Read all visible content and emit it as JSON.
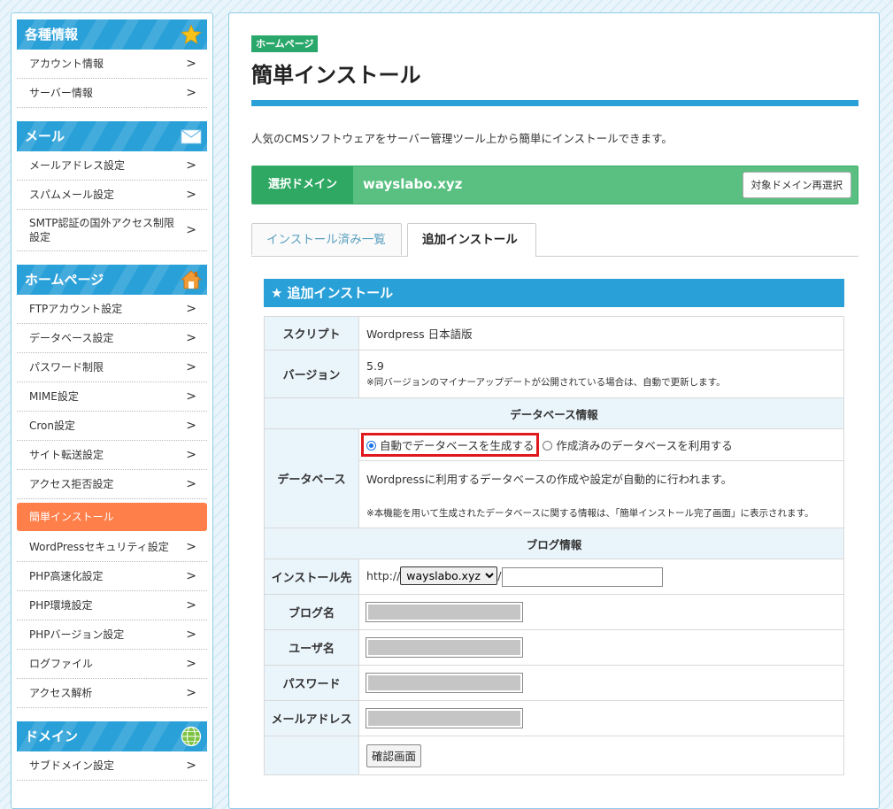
{
  "sidebar": {
    "sections": [
      {
        "title": "各種情報",
        "icon": "star-icon",
        "items": [
          "アカウント情報",
          "サーバー情報"
        ]
      },
      {
        "title": "メール",
        "icon": "envelope-icon",
        "items": [
          "メールアドレス設定",
          "スパムメール設定",
          "SMTP認証の国外アクセス制限設定"
        ]
      },
      {
        "title": "ホームページ",
        "icon": "house-icon",
        "items": [
          "FTPアカウント設定",
          "データベース設定",
          "パスワード制限",
          "MIME設定",
          "Cron設定",
          "サイト転送設定",
          "アクセス拒否設定",
          "簡単インストール",
          "WordPressセキュリティ設定",
          "PHP高速化設定",
          "PHP環境設定",
          "PHPバージョン設定",
          "ログファイル",
          "アクセス解析"
        ],
        "active": "簡単インストール"
      },
      {
        "title": "ドメイン",
        "icon": "globe-icon",
        "items": [
          "サブドメイン設定"
        ]
      }
    ],
    "chevron": ">"
  },
  "main": {
    "badge": "ホームページ",
    "title": "簡単インストール",
    "intro": "人気のCMSソフトウェアをサーバー管理ツール上から簡単にインストールできます。",
    "domain": {
      "label": "選択ドメイン",
      "value": "wayslabo.xyz",
      "reselect_button": "対象ドメイン再選択"
    },
    "tabs": [
      "インストール済み一覧",
      "追加インストール"
    ],
    "active_tab": "追加インストール",
    "panel_title": "追加インストール",
    "form": {
      "script_label": "スクリプト",
      "script_value": "Wordpress 日本語版",
      "version_label": "バージョン",
      "version_value": "5.9",
      "version_note": "※同バージョンのマイナーアップデートが公開されている場合は、自動で更新します。",
      "db_section": "データベース情報",
      "db_label": "データベース",
      "db_option_auto": "自動でデータベースを生成する",
      "db_option_existing": "作成済みのデータベースを利用する",
      "db_description": "Wordpressに利用するデータベースの作成や設定が自動的に行われます。",
      "db_note": "※本機能を用いて生成されたデータベースに関する情報は、「簡単インストール完了画面」に表示されます。",
      "blog_section": "ブログ情報",
      "install_label": "インストール先",
      "install_prefix": "http://",
      "install_domain": "wayslabo.xyz",
      "install_sep": "/",
      "install_path": "",
      "blog_name_label": "ブログ名",
      "user_label": "ユーザ名",
      "password_label": "パスワード",
      "email_label": "メールアドレス",
      "confirm_button": "確認画面"
    }
  },
  "colors": {
    "accent": "#29a0d8",
    "green": "#59c081",
    "dark_green": "#2ea863",
    "active_nav": "#ff7f4a",
    "highlight": "#e0191e"
  }
}
